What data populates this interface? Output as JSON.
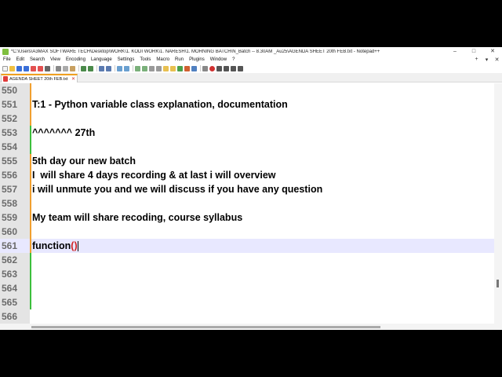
{
  "window": {
    "title": "*C:\\Users\\A3MAX SOFTWARE TECH\\Desktop\\WORK\\1. KODI WORK\\1. NARESH\\1. MORNING BATCH\\N_Batch -- 8.30AM _Au25\\AGENDA SHEET 20th FEB.txt - Notepad++",
    "controls": {
      "minimize": "–",
      "maximize": "□",
      "close": "✕"
    }
  },
  "menu": {
    "items": [
      "File",
      "Edit",
      "Search",
      "View",
      "Encoding",
      "Language",
      "Settings",
      "Tools",
      "Macro",
      "Run",
      "Plugins",
      "Window",
      "?"
    ],
    "right": {
      "add": "+",
      "dropdown": "▾",
      "close": "✕"
    }
  },
  "tab": {
    "label": "AGENDA SHEET 20th FEB.txt",
    "close": "✕"
  },
  "editor": {
    "lines": [
      {
        "num": "550",
        "text": "",
        "mark": "orange"
      },
      {
        "num": "551",
        "text": "T:1 - Python variable class explanation, documentation",
        "mark": "orange"
      },
      {
        "num": "552",
        "text": "",
        "mark": "orange"
      },
      {
        "num": "553",
        "text": "^^^^^^^ 27th",
        "mark": "green"
      },
      {
        "num": "554",
        "text": "",
        "mark": "green"
      },
      {
        "num": "555",
        "text": "5th day our new batch",
        "mark": "orange"
      },
      {
        "num": "556",
        "text": "I  will share 4 days recording & at last i will overview",
        "mark": "orange"
      },
      {
        "num": "557",
        "text": "i will unmute you and we will discuss if you have any question",
        "mark": "orange"
      },
      {
        "num": "558",
        "text": "",
        "mark": "orange"
      },
      {
        "num": "559",
        "text": "My team will share recoding, course syllabus",
        "mark": "orange"
      },
      {
        "num": "560",
        "text": "",
        "mark": "orange"
      },
      {
        "num": "561",
        "text": "function",
        "mark": "orange",
        "current": true,
        "suffix": "()"
      },
      {
        "num": "562",
        "text": "",
        "mark": "green"
      },
      {
        "num": "563",
        "text": "",
        "mark": "green"
      },
      {
        "num": "564",
        "text": "",
        "mark": "green"
      },
      {
        "num": "565",
        "text": "",
        "mark": "green"
      },
      {
        "num": "566",
        "text": "",
        "mark": "none"
      }
    ]
  },
  "colors": {
    "orange_mark": "#f0a030",
    "green_mark": "#3cbf3c",
    "current_line": "#e8e8ff",
    "gutter": "#e4e4e4"
  }
}
